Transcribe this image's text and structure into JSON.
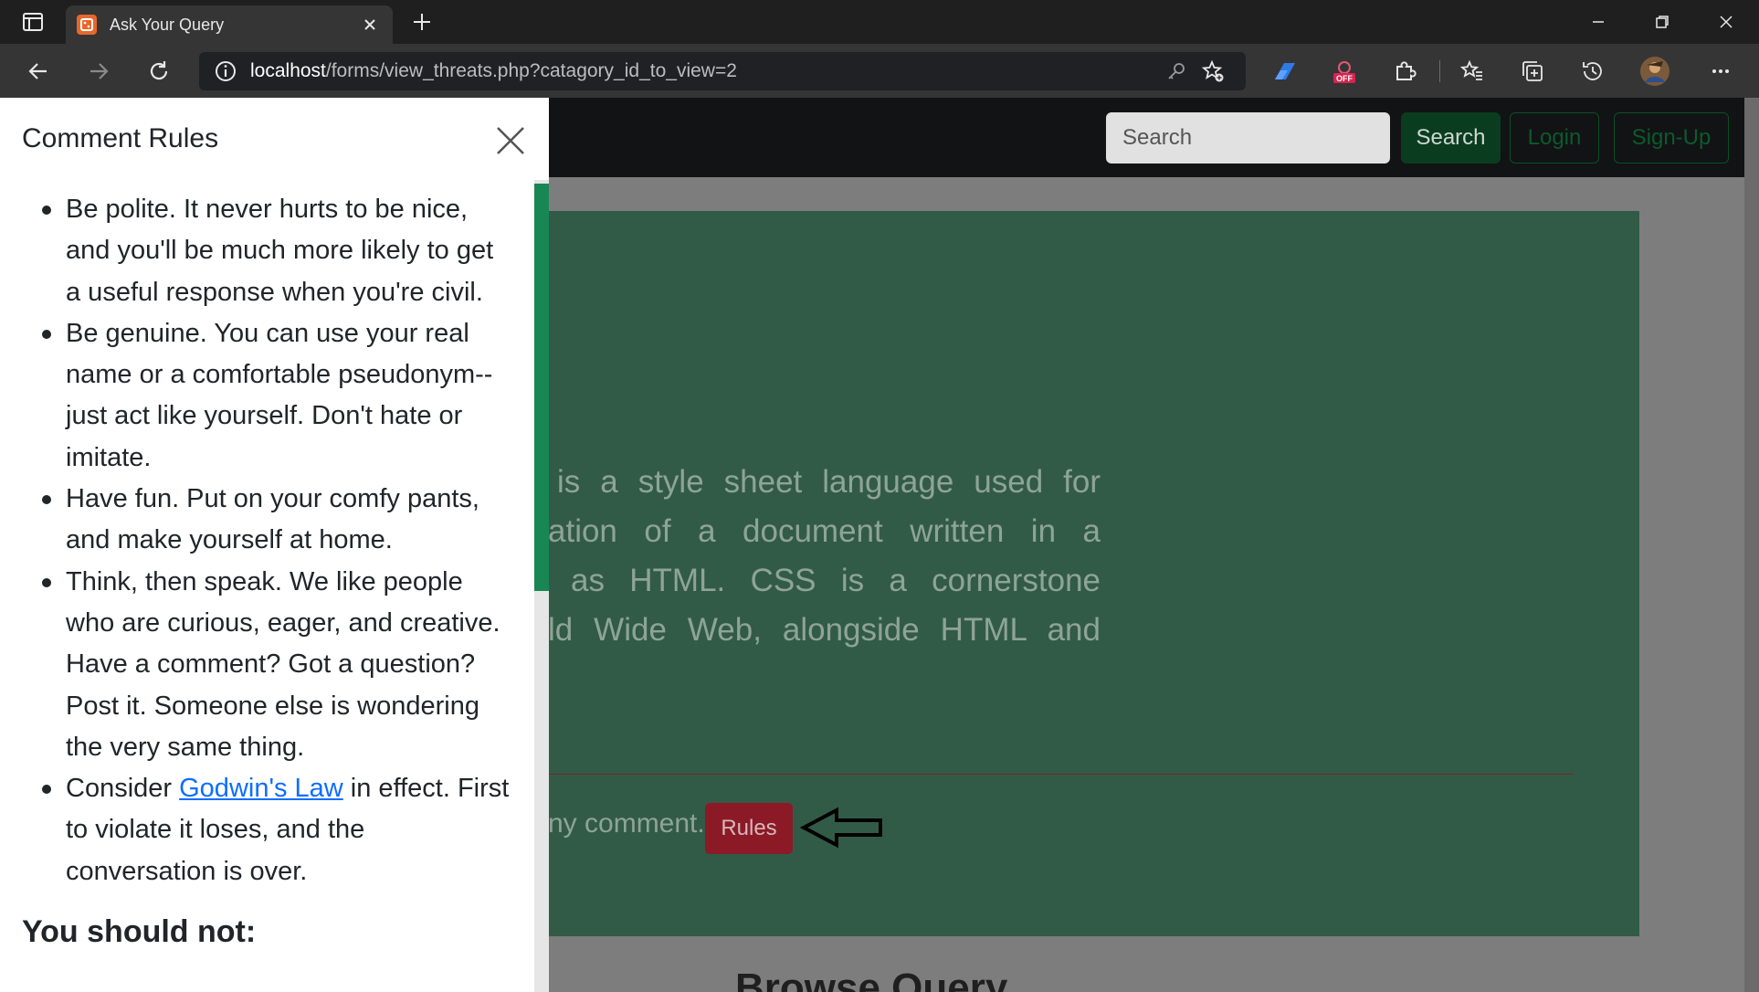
{
  "browser": {
    "tab_title": "Ask Your Query",
    "tab_favicon_text": "⚀",
    "url_host": "localhost",
    "url_path": "/forms/view_threats.php?catagory_id_to_view=2",
    "extension_badge": "OFF"
  },
  "navbar": {
    "search_placeholder": "Search",
    "search_button": "Search",
    "login_button": "Login",
    "signup_button": "Sign-Up"
  },
  "jumbotron": {
    "text_lines": [
      "is a style sheet language used for",
      "ation of a document written in a",
      "as HTML. CSS is a cornerstone",
      "ld Wide Web, alongside HTML and"
    ],
    "note_fragment": "ny comment.",
    "rules_button": "Rules"
  },
  "browse_heading": "Browse Query",
  "offcanvas": {
    "title": "Comment Rules",
    "rules": [
      {
        "text": "Be polite. It never hurts to be nice, and you'll be much more likely to get a useful response when you're civil."
      },
      {
        "text": "Be genuine. You can use your real name or a comfortable pseudonym--just act like yourself. Don't hate or imitate."
      },
      {
        "text": "Have fun. Put on your comfy pants, and make yourself at home."
      },
      {
        "text": "Think, then speak. We like people who are curious, eager, and creative. Have a comment? Got a question? Post it. Someone else is wondering the very same thing."
      },
      {
        "prefix": "Consider ",
        "link": "Godwin's Law",
        "suffix": " in effect. First to violate it loses, and the conversation is over."
      }
    ],
    "subheading": "You should not:"
  },
  "colors": {
    "accent_green": "#198754",
    "rules_red": "#8b1a26",
    "jumbotron_bg": "#325b47",
    "link_blue": "#0d6efd"
  }
}
